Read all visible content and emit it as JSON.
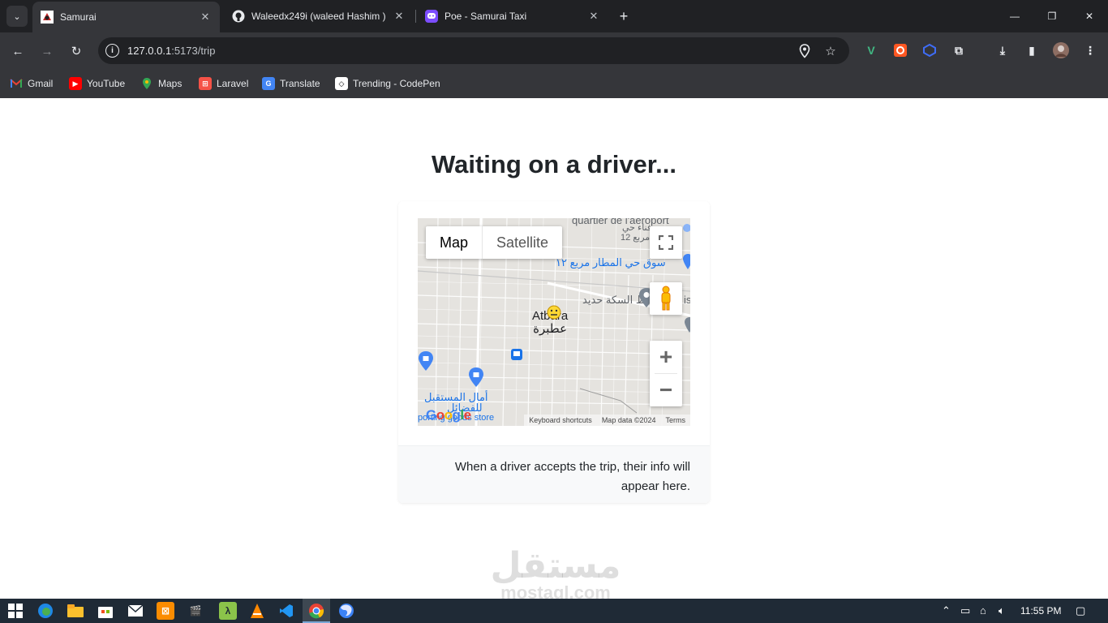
{
  "browser": {
    "tabs": [
      {
        "title": "Samurai",
        "active": true,
        "favicon": "samurai-favicon"
      },
      {
        "title": "Waleedx249i (waleed Hashim )",
        "active": false,
        "favicon": "github-icon"
      },
      {
        "title": "Poe - Samurai Taxi",
        "active": false,
        "favicon": "poe-icon"
      }
    ],
    "url_host": "127.0.0.1",
    "url_path": ":5173/trip",
    "bookmarks": [
      {
        "label": "Gmail",
        "icon": "gmail-icon",
        "color": "#ea4335"
      },
      {
        "label": "YouTube",
        "icon": "youtube-icon",
        "color": "#ff0000"
      },
      {
        "label": "Maps",
        "icon": "maps-icon",
        "color": "#34a853"
      },
      {
        "label": "Laravel",
        "icon": "laravel-icon",
        "color": "#f55247"
      },
      {
        "label": "Translate",
        "icon": "translate-icon",
        "color": "#4285f4"
      },
      {
        "label": "Trending - CodePen",
        "icon": "codepen-icon",
        "color": "#ffffff"
      }
    ]
  },
  "page": {
    "title": "Waiting on a driver...",
    "footer_text": "When a driver accepts the trip, their info will appear here."
  },
  "map": {
    "type_map": "Map",
    "type_satellite": "Satellite",
    "zoom_in": "+",
    "zoom_out": "−",
    "labels": {
      "quartier": "quartier de l'aéroport",
      "fina": "فناء حي",
      "square12": "مربع 12",
      "souq": "سوق حي المطار مربع ١٢",
      "railway": "خط السكة حديد",
      "city_latin": "Atbara",
      "city_arabic": "عطبرة",
      "amal": "أمال المستقبل",
      "lil": "للفضائل",
      "sporting": "porting goods store",
      "is": "is"
    },
    "google": "Google",
    "attrib_shortcuts": "Keyboard shortcuts",
    "attrib_data": "Map data ©2024",
    "attrib_terms": "Terms"
  },
  "watermark": {
    "arabic": "مستقل",
    "latin": "mostaql.com"
  },
  "taskbar": {
    "time": "11:55 PM",
    "apps": [
      "edge-icon",
      "file-explorer-icon",
      "store-icon",
      "mail-icon",
      "xampp-icon",
      "clapper-icon",
      "lambda-icon",
      "vlc-icon",
      "vscode-icon",
      "chrome-icon",
      "firefox-icon"
    ]
  }
}
